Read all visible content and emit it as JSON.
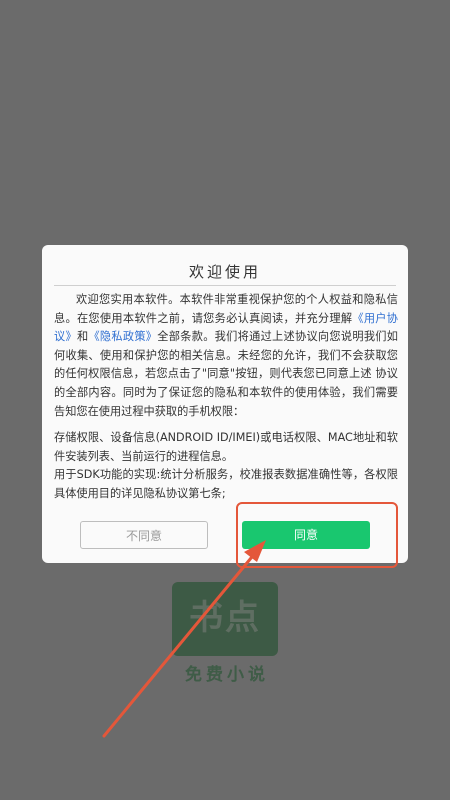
{
  "dialog": {
    "title": "欢迎使用",
    "para1_before": "欢迎您实用本软件。本软件非常重视保护您的个人权益和隐私信息。在您使用本软件之前，请您务必认真阅读，并充分理解",
    "link_user_agreement": "《用户协议》",
    "and_text": "和",
    "link_privacy_policy": "《隐私政策》",
    "para1_after": "全部条款。我们将通过上述协议向您说明我们如何收集、使用和保护您的相关信息。未经您的允许，我们不会获取您的任何权限信息，若您点击了\"同意\"按钮，则代表您已同意上述 协议的全部内容。同时为了保证您的隐私和本软件的使用体验，我们需要告知您在使用过程中获取的手机权限：",
    "para2": "存储权限、设备信息(ANDROID ID/IMEI)或电话权限、MAC地址和软件安装列表、当前运行的进程信息。",
    "para3": "用于SDK功能的实现:统计分析服务，校准报表数据准确性等，各权限具体使用目的详见隐私协议第七条;",
    "disagree_label": "不同意",
    "agree_label": "同意"
  },
  "background": {
    "logo_text": "书点",
    "logo_subtitle": "免费小说"
  },
  "colors": {
    "agree_button": "#19c76f",
    "link": "#2f6fd1",
    "annotation": "#e4573a"
  }
}
